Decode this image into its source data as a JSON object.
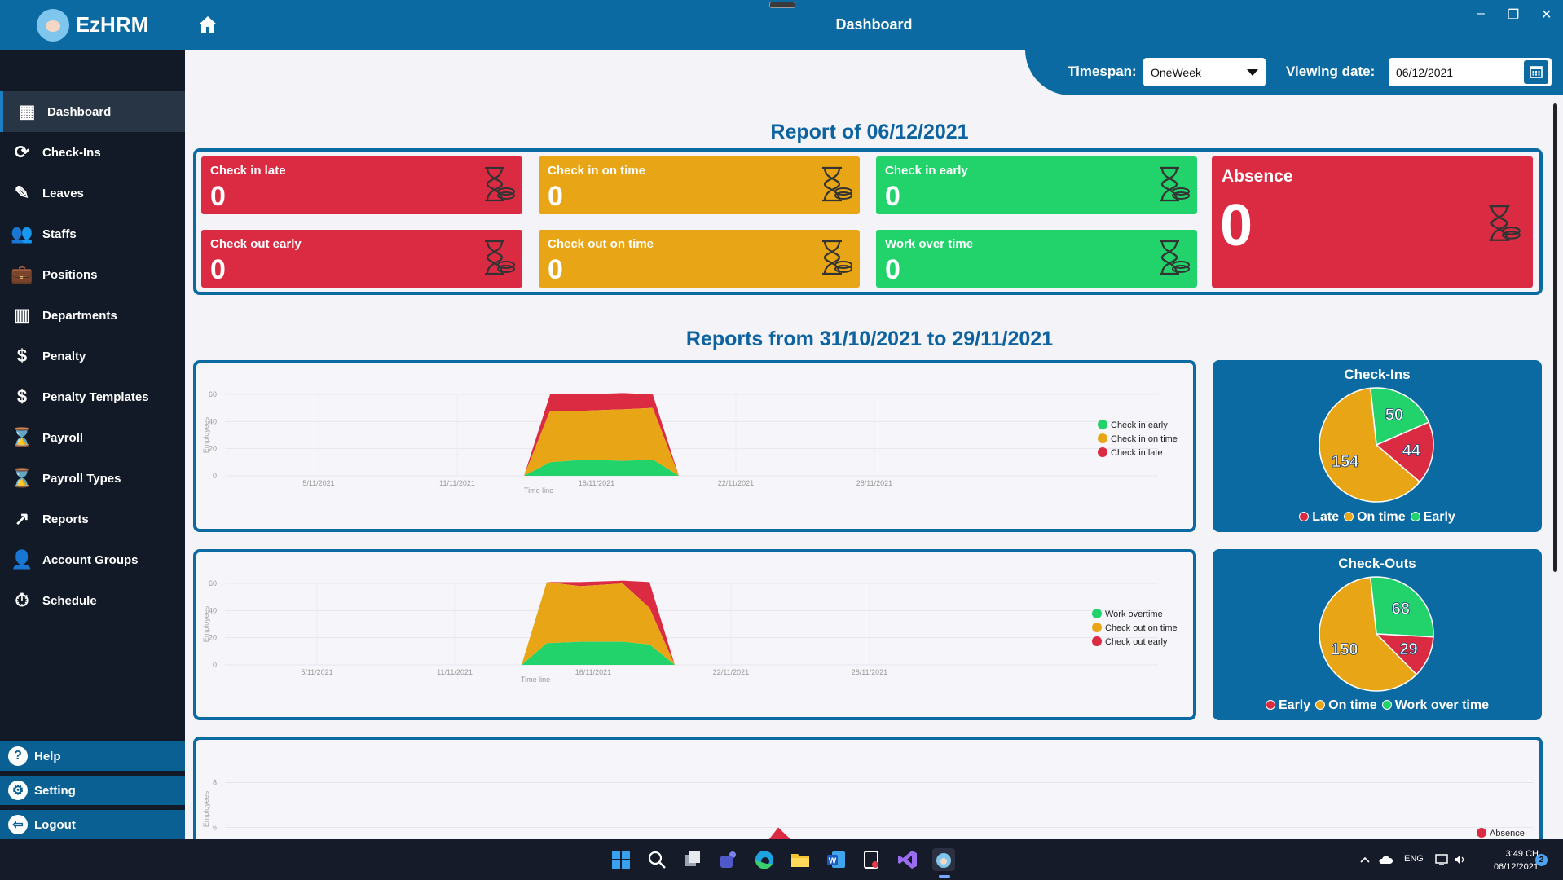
{
  "app": {
    "name": "EzHRM",
    "page_title": "Dashboard"
  },
  "sidebar": {
    "items": [
      {
        "label": "Dashboard",
        "icon": "dashboard-icon"
      },
      {
        "label": "Check-Ins",
        "icon": "check-ins-icon"
      },
      {
        "label": "Leaves",
        "icon": "leaves-icon"
      },
      {
        "label": "Staffs",
        "icon": "staffs-icon"
      },
      {
        "label": "Positions",
        "icon": "positions-icon"
      },
      {
        "label": "Departments",
        "icon": "departments-icon"
      },
      {
        "label": "Penalty",
        "icon": "penalty-icon"
      },
      {
        "label": "Penalty Templates",
        "icon": "penalty-templates-icon"
      },
      {
        "label": "Payroll",
        "icon": "payroll-icon"
      },
      {
        "label": "Payroll Types",
        "icon": "payroll-types-icon"
      },
      {
        "label": "Reports",
        "icon": "reports-icon"
      },
      {
        "label": "Account Groups",
        "icon": "account-groups-icon"
      },
      {
        "label": "Schedule",
        "icon": "schedule-icon"
      }
    ],
    "bottom": [
      {
        "label": "Help",
        "icon": "help-icon"
      },
      {
        "label": "Setting",
        "icon": "gear-icon"
      },
      {
        "label": "Logout",
        "icon": "logout-icon"
      }
    ]
  },
  "filters": {
    "timespan_label": "Timespan:",
    "timespan_value": "OneWeek",
    "viewing_date_label": "Viewing date:",
    "viewing_date_value": "06/12/2021"
  },
  "report": {
    "title": "Report of 06/12/2021",
    "cards": [
      {
        "label": "Check in late",
        "value": "0"
      },
      {
        "label": "Check in on time",
        "value": "0"
      },
      {
        "label": "Check in early",
        "value": "0"
      },
      {
        "label": "Check out early",
        "value": "0"
      },
      {
        "label": "Check out on time",
        "value": "0"
      },
      {
        "label": "Work over time",
        "value": "0"
      }
    ],
    "absence": {
      "label": "Absence",
      "value": "0"
    }
  },
  "range_title": "Reports from 31/10/2021 to 29/11/2021",
  "colors": {
    "red": "#db2b42",
    "orange": "#e8a616",
    "green": "#21d36a",
    "blue": "#0a6aa1"
  },
  "chart_data": [
    {
      "type": "area",
      "x_ticks": [
        "5/11/2021",
        "11/11/2021",
        "16/11/2021",
        "22/11/2021",
        "28/11/2021"
      ],
      "x": [
        "14/11/2021",
        "15/11/2021",
        "16/11/2021",
        "17/11/2021",
        "18/11/2021",
        "19/11/2021"
      ],
      "xlabel": "Time line",
      "ylabel": "Employees",
      "ylim": [
        0,
        60
      ],
      "y_ticks": [
        0,
        20,
        40,
        60
      ],
      "stacked": true,
      "series": [
        {
          "name": "Check in early",
          "color": "#21d36a",
          "values": [
            0,
            10,
            12,
            11,
            12,
            0
          ]
        },
        {
          "name": "Check in on time",
          "color": "#e8a616",
          "values": [
            0,
            38,
            36,
            38,
            38,
            0
          ]
        },
        {
          "name": "Check in late",
          "color": "#db2b42",
          "values": [
            0,
            12,
            12,
            12,
            10,
            0
          ]
        }
      ]
    },
    {
      "type": "area",
      "x_ticks": [
        "5/11/2021",
        "11/11/2021",
        "16/11/2021",
        "22/11/2021",
        "28/11/2021"
      ],
      "x": [
        "14/11/2021",
        "15/11/2021",
        "16/11/2021",
        "17/11/2021",
        "18/11/2021",
        "19/11/2021"
      ],
      "xlabel": "Time line",
      "ylabel": "Employees",
      "ylim": [
        0,
        60
      ],
      "y_ticks": [
        0,
        20,
        40,
        60
      ],
      "stacked": true,
      "series": [
        {
          "name": "Work overtime",
          "color": "#21d36a",
          "values": [
            0,
            16,
            17,
            17,
            15,
            0
          ]
        },
        {
          "name": "Check out on time",
          "color": "#e8a616",
          "values": [
            0,
            45,
            41,
            43,
            27,
            0
          ]
        },
        {
          "name": "Check out early",
          "color": "#db2b42",
          "values": [
            0,
            0,
            3,
            2,
            19,
            0
          ]
        }
      ]
    },
    {
      "type": "pie",
      "title": "Check-Ins",
      "slices": [
        {
          "label": "Early",
          "value": 50,
          "color": "#21d36a"
        },
        {
          "label": "Late",
          "value": 44,
          "color": "#db2b42"
        },
        {
          "label": "On time",
          "value": 154,
          "color": "#e8a616"
        }
      ],
      "legend": [
        "Late",
        "On time",
        "Early"
      ]
    },
    {
      "type": "pie",
      "title": "Check-Outs",
      "slices": [
        {
          "label": "Work over time",
          "value": 68,
          "color": "#21d36a"
        },
        {
          "label": "Early",
          "value": 29,
          "color": "#db2b42"
        },
        {
          "label": "On time",
          "value": 150,
          "color": "#e8a616"
        }
      ],
      "legend": [
        "Early",
        "On time",
        "Work over time"
      ]
    },
    {
      "type": "area",
      "ylabel": "Employees",
      "y_ticks": [
        4,
        6,
        8
      ],
      "ylim": [
        3,
        9
      ],
      "series": [
        {
          "name": "Absence",
          "color": "#db2b42",
          "values": [
            0,
            6,
            0
          ]
        }
      ]
    }
  ],
  "taskbar": {
    "lang": "ENG",
    "time": "3:49 CH",
    "date": "06/12/2021",
    "notifications": "2"
  }
}
